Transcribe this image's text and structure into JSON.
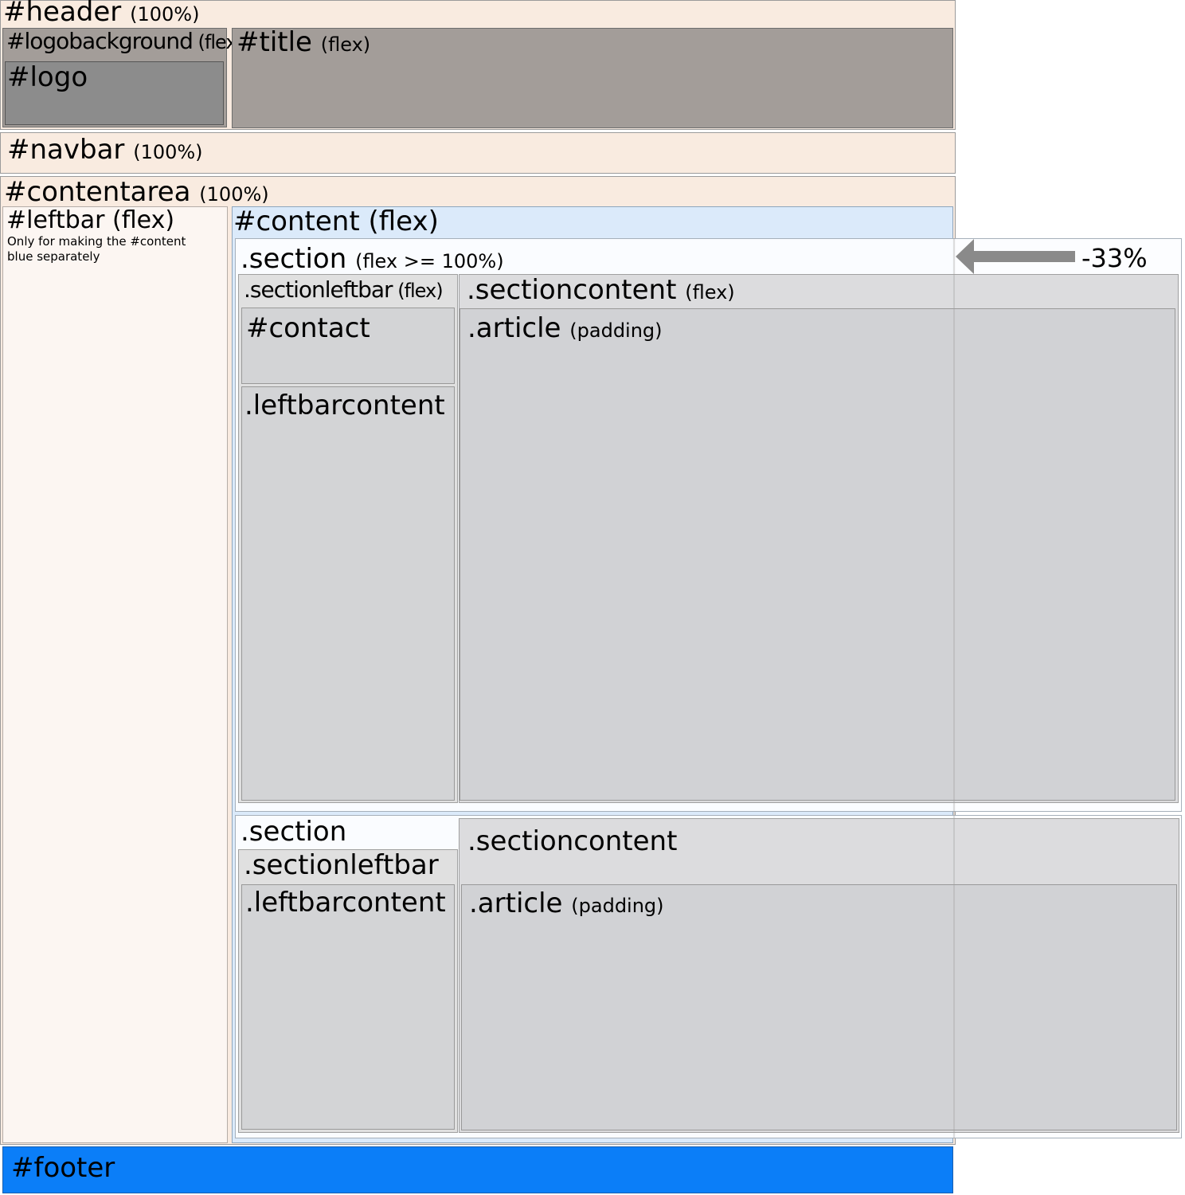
{
  "header": {
    "name": "#header",
    "note": "(100%)"
  },
  "logobackground": {
    "name": "#logobackground",
    "note": "(flex)"
  },
  "logo": {
    "name": "#logo"
  },
  "title": {
    "name": "#title",
    "note": "(flex)"
  },
  "navbar": {
    "name": "#navbar",
    "note": "(100%)"
  },
  "contentarea": {
    "name": "#contentarea",
    "note": "(100%)"
  },
  "leftbar": {
    "name": "#leftbar",
    "note": "(flex)",
    "description_line1": "Only for making the #content",
    "description_line2": "blue separately"
  },
  "content": {
    "name": "#content",
    "note": "(flex)"
  },
  "section1": {
    "name": ".section",
    "note": "(flex >= 100%)",
    "sectionleftbar": {
      "name": ".sectionleftbar",
      "note": "(flex)"
    },
    "contact": {
      "name": "#contact"
    },
    "leftbarcontent": {
      "name": ".leftbarcontent"
    },
    "sectioncontent": {
      "name": ".sectioncontent",
      "note": "(flex)"
    },
    "article": {
      "name": ".article",
      "note": "(padding)"
    }
  },
  "section2": {
    "name": ".section",
    "sectionleftbar": {
      "name": ".sectionleftbar"
    },
    "leftbarcontent": {
      "name": ".leftbarcontent"
    },
    "sectioncontent": {
      "name": ".sectioncontent"
    },
    "article": {
      "name": ".article",
      "note": "(padding)"
    }
  },
  "shrink_annotation": "-33%",
  "footer": {
    "name": "#footer"
  },
  "colors": {
    "header": "#f9ebe0",
    "title": "#a39d99",
    "content": "#dbeafa",
    "footer": "#0b7ef8",
    "arrow": "#8a8a8a"
  }
}
